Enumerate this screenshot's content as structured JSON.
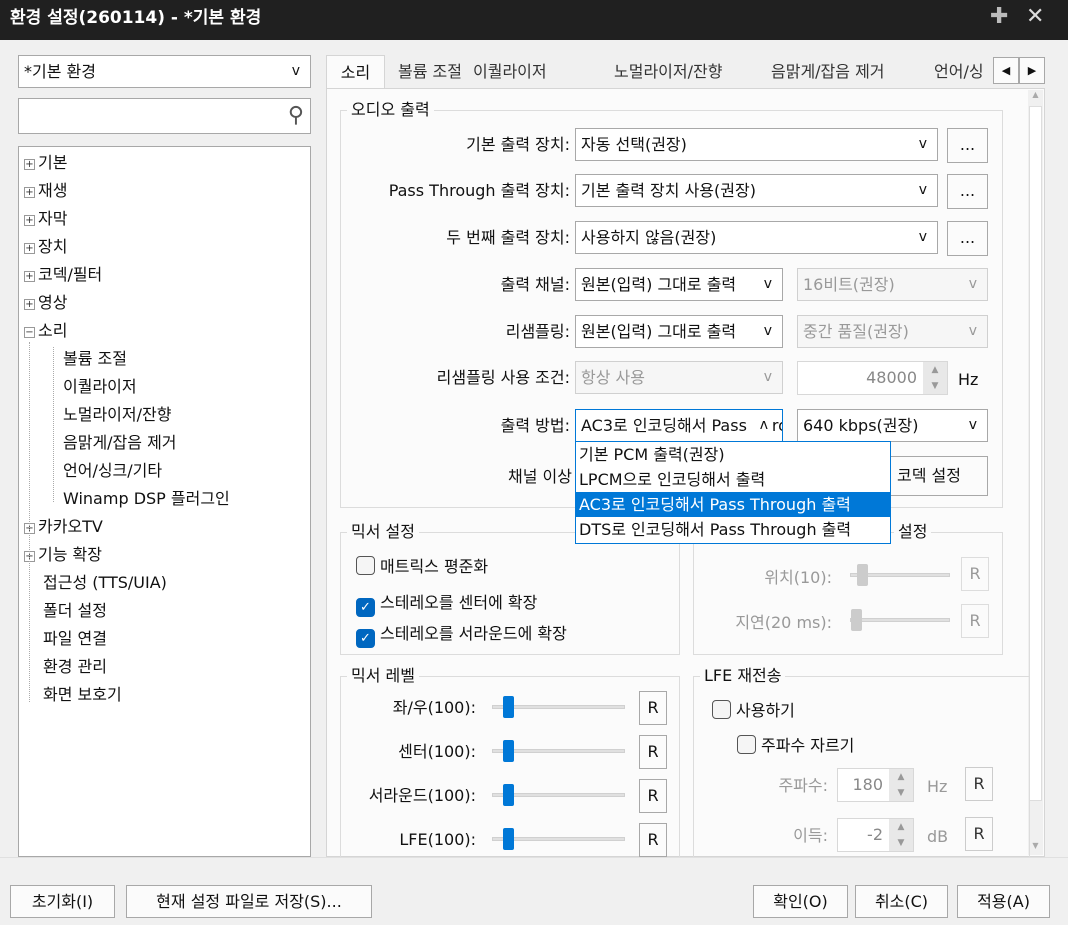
{
  "window": {
    "title": "환경 설정(260114) - *기본 환경",
    "pin_icon": "pin-icon",
    "close_icon": "close-icon"
  },
  "sidebar": {
    "profile": "*기본 환경",
    "search_placeholder": "",
    "tree": [
      {
        "label": "기본",
        "expand": "+"
      },
      {
        "label": "재생",
        "expand": "+"
      },
      {
        "label": "자막",
        "expand": "+"
      },
      {
        "label": "장치",
        "expand": "+"
      },
      {
        "label": "코덱/필터",
        "expand": "+"
      },
      {
        "label": "영상",
        "expand": "+"
      },
      {
        "label": "소리",
        "expand": "−"
      }
    ],
    "sound_children": [
      "볼륨 조절",
      "이퀄라이저",
      "노멀라이저/잔향",
      "음맑게/잡음 제거",
      "언어/싱크/기타",
      "Winamp DSP 플러그인"
    ],
    "tree2": [
      {
        "label": "카카오TV",
        "expand": "+"
      },
      {
        "label": "기능 확장",
        "expand": "+"
      }
    ],
    "leaves": [
      "접근성 (TTS/UIA)",
      "폴더 설정",
      "파일 연결",
      "환경 관리",
      "화면 보호기"
    ]
  },
  "tabs": [
    "소리",
    "볼륨 조절",
    "이퀄라이저",
    "노멀라이저/잔향",
    "음맑게/잡음 제거",
    "언어/싱"
  ],
  "audio": {
    "title": "오디오 출력",
    "default_device_label": "기본 출력 장치:",
    "default_device": "자동 선택(권장)",
    "passthrough_label": "Pass Through 출력 장치:",
    "passthrough": "기본 출력 장치 사용(권장)",
    "second_label": "두 번째 출력 장치:",
    "second": "사용하지 않음(권장)",
    "more": "...",
    "channel_label": "출력 채널:",
    "channel": "원본(입력) 그대로 출력",
    "bits": "16비트(권장)",
    "resample_label": "리샘플링:",
    "resample": "원본(입력) 그대로 출력",
    "quality": "중간 품질(권장)",
    "resample_cond_label": "리샘플링 사용 조건:",
    "resample_cond": "항상 사용",
    "rate": "48000",
    "hz": "Hz",
    "method_label": "출력 방법:",
    "method": "AC3로 인코딩해서 Pass Through 출력",
    "bitrate": "640 kbps(권장)",
    "channel_over_label": "채널 이상",
    "codec_button": "코덱 설정",
    "method_options": [
      "기본 PCM 출력(권장)",
      "LPCM으로 인코딩해서 출력",
      "AC3로 인코딩해서 Pass Through 출력",
      "DTS로 인코딩해서 Pass Through 출력"
    ],
    "selected_option": 2
  },
  "mixer": {
    "title": "믹서 설정",
    "matrix": "매트릭스 평준화",
    "matrix_checked": false,
    "center": "스테레오를 센터에 확장",
    "center_checked": true,
    "surround": "스테레오를 서라운드에 확장",
    "surround_checked": true
  },
  "center_group": {
    "title": "설정",
    "pos": "위치(10):",
    "delay": "지연(20 ms):",
    "pos_value": 10,
    "delay_value": 20
  },
  "levels": {
    "title": "믹서 레벨",
    "items": [
      {
        "label": "좌/우(100):",
        "value": 100
      },
      {
        "label": "센터(100):",
        "value": 100
      },
      {
        "label": "서라운드(100):",
        "value": 100
      },
      {
        "label": "LFE(100):",
        "value": 100
      }
    ],
    "reset": "R"
  },
  "lfe": {
    "title": "LFE 재전송",
    "use": "사용하기",
    "cut": "주파수 자르기",
    "freq_label": "주파수:",
    "freq": "180",
    "freq_unit": "Hz",
    "gain_label": "이득:",
    "gain": "-2",
    "gain_unit": "dB"
  },
  "footer": {
    "reset": "초기화(I)",
    "save": "현재 설정 파일로 저장(S)...",
    "ok": "확인(O)",
    "cancel": "취소(C)",
    "apply": "적용(A)"
  }
}
